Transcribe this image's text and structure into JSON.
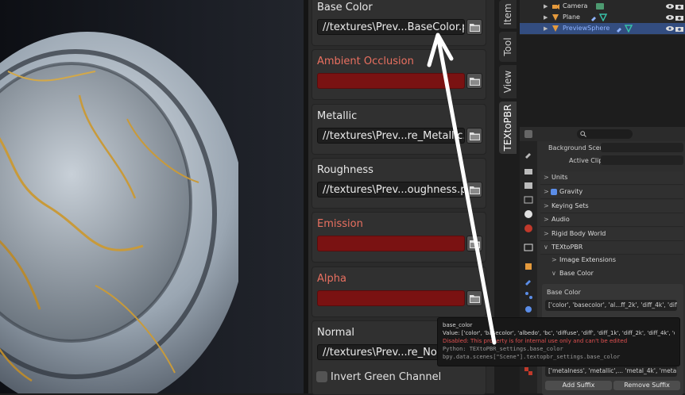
{
  "pbr_slots": [
    {
      "label": "Base Color",
      "path": "//textures\\Prev...BaseColor.png",
      "missing": false
    },
    {
      "label": "Ambient Occlusion",
      "path": "",
      "missing": true
    },
    {
      "label": "Metallic",
      "path": "//textures\\Prev...re_Metallic.png",
      "missing": false
    },
    {
      "label": "Roughness",
      "path": "//textures\\Prev...oughness.png",
      "missing": false
    },
    {
      "label": "Emission",
      "path": "",
      "missing": true
    },
    {
      "label": "Alpha",
      "path": "",
      "missing": true
    },
    {
      "label": "Normal",
      "path": "//textures\\Prev...re_Normal.png",
      "missing": false
    }
  ],
  "invert_green": {
    "label": "Invert Green Channel",
    "checked": false
  },
  "tabs": [
    "Item",
    "Tool",
    "View",
    "TEXtoPBR"
  ],
  "active_tab": "TEXtoPBR",
  "outliner": [
    {
      "name": "Camera",
      "icon": "camera-icon",
      "selected": false
    },
    {
      "name": "Plane",
      "icon": "mesh-icon",
      "selected": false
    },
    {
      "name": "PreviewSphere",
      "icon": "mesh-icon",
      "selected": true
    }
  ],
  "props": {
    "background_scene_label": "Background Scene",
    "active_clip_label": "Active Clip",
    "units": "Units",
    "gravity": "Gravity",
    "keying_sets": "Keying Sets",
    "audio": "Audio",
    "rigid_body_world": "Rigid Body World",
    "texto_pbr": "TEXtoPBR",
    "image_extensions": "Image Extensions",
    "base_color_section": "Base Color",
    "base_color_label": "Base Color",
    "base_color_list": "['color', 'basecolor', 'al...ff_2k', 'diff_4k', 'diff_8k']",
    "metalness_list": "['metalness', 'metallic',... 'metal_4k', 'metal_8k']",
    "add_suffix": "Add Suffix",
    "remove_suffix": "Remove Suffix"
  },
  "tooltip": {
    "title": "base_color",
    "value": "Value: ['color', 'basecolor', 'albedo', 'bc', 'diffuse', 'diff', 'diff_1k', 'diff_2k', 'diff_4k', 'diff_8k']",
    "warning": "Disabled: This property is for internal use only and can't be edited",
    "python": "Python: TEXtoPBR_settings.base_color",
    "path": "bpy.data.scenes[\"Scene\"].textopbr_settings.base_color"
  },
  "colors": {
    "missing_red": "#7a1212",
    "label_red": "#e97060",
    "selection_blue": "#334d80",
    "marble_gold": "#c89a3a"
  }
}
